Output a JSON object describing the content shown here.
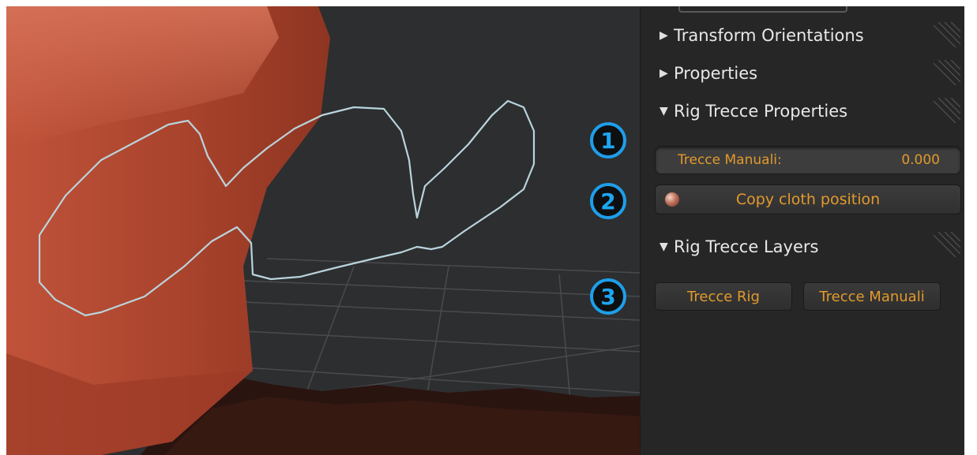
{
  "panel": {
    "sections": [
      {
        "label": "Transform Orientations",
        "expanded": false
      },
      {
        "label": "Properties",
        "expanded": false
      },
      {
        "label": "Rig Trecce Properties",
        "expanded": true
      },
      {
        "label": "Rig Trecce Layers",
        "expanded": true
      }
    ],
    "trecce_field": {
      "label": "Trecce Manuali:",
      "value": "0.000"
    },
    "copy_button": {
      "label": "Copy cloth position"
    },
    "layer_buttons": [
      "Trecce Rig",
      "Trecce Manuali"
    ]
  },
  "badges": [
    "1",
    "2",
    "3"
  ],
  "icons": {
    "collapsed": "▶",
    "expanded": "▼",
    "grip": "panel-drag-grip-icon",
    "sphere": "material-sphere-icon"
  },
  "colors": {
    "accent_text": "#e29a2c",
    "badge": "#1e9eea",
    "panel_bg": "#262626",
    "curve": "#b9d4dc"
  }
}
